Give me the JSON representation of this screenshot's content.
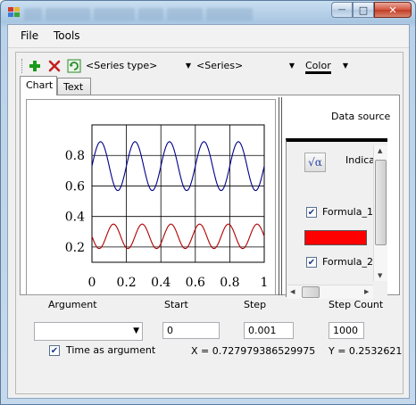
{
  "titlebar": {
    "icon": "app-icon",
    "buttons": [
      {
        "name": "minimize",
        "glyph": "—"
      },
      {
        "name": "maximize",
        "glyph": "□"
      },
      {
        "name": "close",
        "glyph": "✕"
      }
    ]
  },
  "menu": {
    "items": [
      "File",
      "Tools"
    ]
  },
  "toolbar": {
    "add_icon": "plus-icon",
    "delete_icon": "delete-x-icon",
    "refresh_icon": "refresh-icon",
    "series_type": "<Series type>",
    "series": "<Series>",
    "color_label": "Color",
    "colors": {
      "add": "#1a9a1a",
      "delete": "#c42020",
      "refresh": "#2a8a2a"
    }
  },
  "tabs": [
    "Chart",
    "Text"
  ],
  "chart_data": {
    "type": "line",
    "title": "",
    "xlabel": "",
    "ylabel": "",
    "xlim": [
      0,
      1
    ],
    "ylim": [
      0.1,
      1.0
    ],
    "x_ticks": [
      "0",
      "0.2",
      "0.4",
      "0.6",
      "0.8",
      "1"
    ],
    "y_ticks": [
      "0.2",
      "0.4",
      "0.6",
      "0.8"
    ],
    "grid": true,
    "series": [
      {
        "color": "#00008b",
        "amplitude": 0.16,
        "offset": 0.73,
        "cycles": 5,
        "phase": 0
      },
      {
        "color": "#b00000",
        "amplitude": 0.08,
        "offset": 0.27,
        "cycles": 6,
        "phase": 0.5
      }
    ]
  },
  "data_source": {
    "label": "Data source",
    "formula_icon": "sqrt-alpha-icon",
    "formula_glyph": "√α",
    "indicator": "Indica",
    "formula1": "Formula_1",
    "formula1_checked": true,
    "formula1_color": "#ff0000",
    "formula2": "Formula_2",
    "formula2_checked": true
  },
  "bottom": {
    "argument_label": "Argument",
    "argument_value": "",
    "start_label": "Start",
    "start_value": "0",
    "step_label": "Step",
    "step_value": "0.001",
    "step_count_label": "Step Count",
    "step_count_value": "1000",
    "time_as_argument": "Time as argument",
    "time_checked": true,
    "x_readout": "X = 0.727979386529975",
    "y_readout": "Y = 0.2532621"
  }
}
